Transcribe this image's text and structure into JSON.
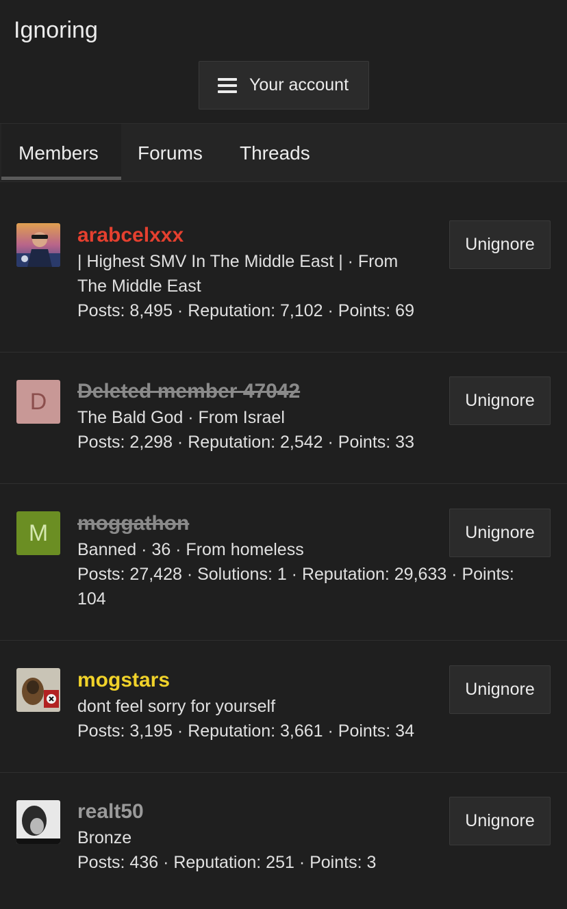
{
  "header": {
    "title": "Ignoring",
    "account_button_label": "Your account"
  },
  "tabs": [
    {
      "label": "Members",
      "active": true
    },
    {
      "label": "Forums",
      "active": false
    },
    {
      "label": "Threads",
      "active": false
    }
  ],
  "members": [
    {
      "username": "arabcelxxx",
      "username_color": "#e5402f",
      "avatar": "photo",
      "line1": "| Highest SMV In The Middle East | · From",
      "line2": "The Middle East",
      "stats": "Posts: 8,495 · Reputation: 7,102 · Points: 69",
      "button": "Unignore"
    },
    {
      "username": "Deleted member 47042",
      "username_color": "#8a8a8a",
      "avatar": "letter",
      "avatar_letter": "D",
      "avatar_bg": "#c89896",
      "avatar_fg": "#8c4f4d",
      "line1": "The Bald God · From Israel",
      "stats": "Posts: 2,298 · Reputation: 2,542 · Points: 33",
      "button": "Unignore"
    },
    {
      "username": "moggathon",
      "username_color": "#8a8a8a",
      "avatar": "letter",
      "avatar_letter": "M",
      "avatar_bg": "#6b8e23",
      "avatar_fg": "#d6e8b0",
      "line1": "Banned · 36 · From homeless",
      "line2": "Posts: 27,428 · Solutions: 1 · Reputation: 29,633 · Points:",
      "stats": "104",
      "button": "Unignore"
    },
    {
      "username": "mogstars",
      "username_color": "#f0d22a",
      "avatar": "photo",
      "line1": "dont feel sorry for yourself",
      "stats": "Posts: 3,195 · Reputation: 3,661 · Points: 34",
      "button": "Unignore"
    },
    {
      "username": "realt50",
      "username_color": "#9a9a9a",
      "avatar": "photo",
      "line1": "Bronze",
      "stats": "Posts: 436 · Reputation: 251 · Points: 3",
      "button": "Unignore"
    }
  ]
}
